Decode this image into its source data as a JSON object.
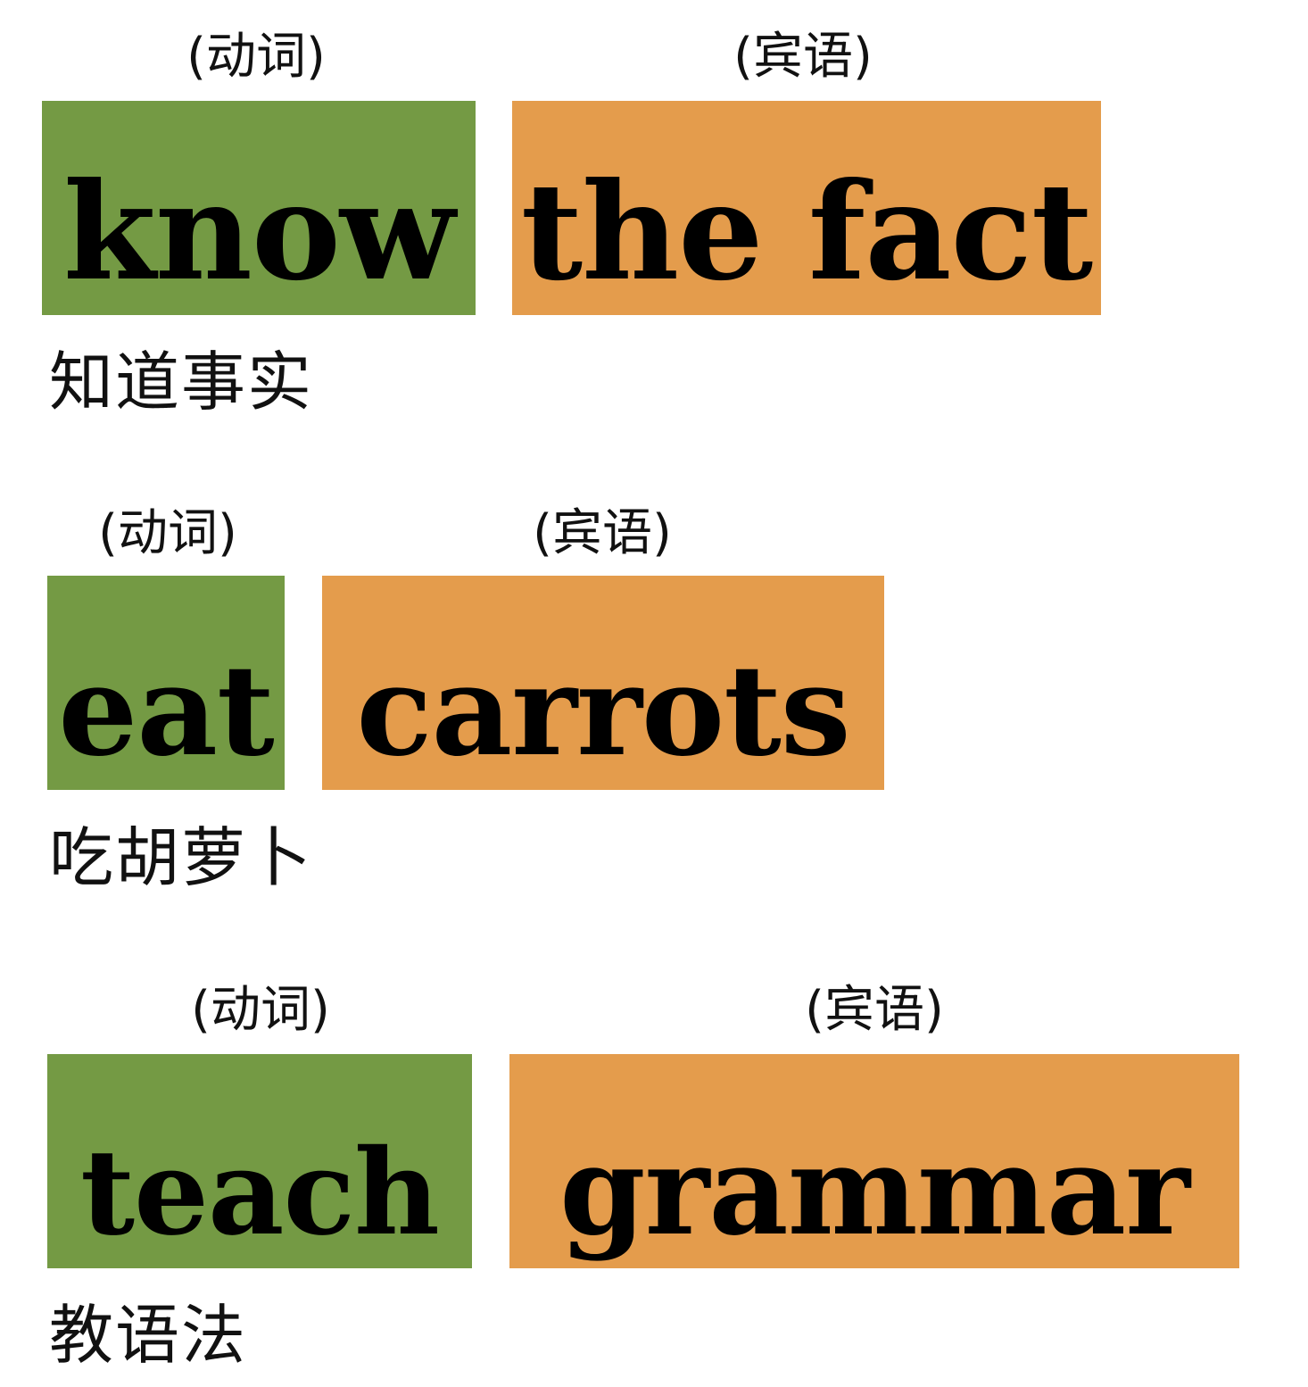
{
  "colors": {
    "verb_block": "#749a44",
    "object_block": "#e49c4c",
    "text": "#000000",
    "background": "#ffffff"
  },
  "rows": [
    {
      "verb_role": "(动词)",
      "verb": "know",
      "object_role": "(宾语)",
      "object": "the fact",
      "translation": "知道事实"
    },
    {
      "verb_role": "(动词)",
      "verb": "eat",
      "object_role": "(宾语)",
      "object": "carrots",
      "translation": "吃胡萝卜"
    },
    {
      "verb_role": "(动词)",
      "verb": "teach",
      "object_role": "(宾语)",
      "object": "grammar",
      "translation": "教语法"
    }
  ]
}
